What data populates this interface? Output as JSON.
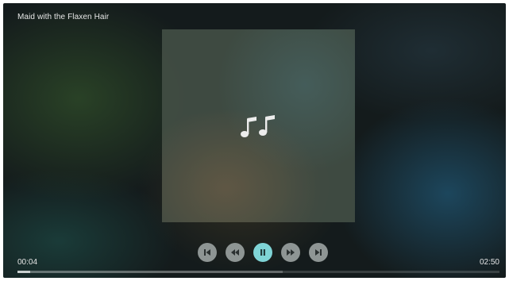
{
  "track": {
    "title": "Maid with the Flaxen Hair"
  },
  "album_art": {
    "icon": "music-notes-icon"
  },
  "controls": [
    {
      "name": "skip-previous-button",
      "icon": "skip-previous-icon"
    },
    {
      "name": "rewind-button",
      "icon": "rewind-icon"
    },
    {
      "name": "pause-button",
      "icon": "pause-icon"
    },
    {
      "name": "fast-forward-button",
      "icon": "fast-forward-icon"
    },
    {
      "name": "skip-next-button",
      "icon": "skip-next-icon"
    }
  ],
  "playback": {
    "current_time": "00:04",
    "total_time": "02:50",
    "progress_fraction": 0.027,
    "buffered_fraction": 0.55
  },
  "colors": {
    "accent": "#7fd4d6",
    "control_bg": "#8e9594",
    "icon_glyph": "#2a3030"
  }
}
